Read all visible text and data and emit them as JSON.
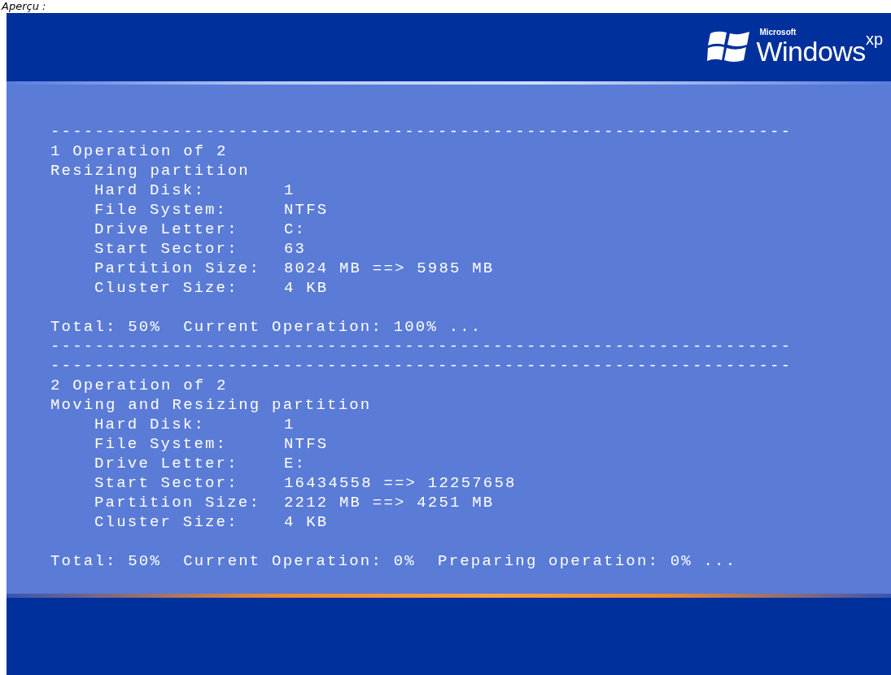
{
  "caption": "Aperçu :",
  "logo": {
    "company": "Microsoft",
    "product": "Windows",
    "edition": "xp"
  },
  "operations": [
    {
      "rule_top": "-------------------------------------------------------------------",
      "counter": "1 Operation of 2",
      "action": "Resizing partition",
      "fields": [
        {
          "label": "Hard Disk:",
          "value": "1"
        },
        {
          "label": "File System:",
          "value": "NTFS"
        },
        {
          "label": "Drive Letter:",
          "value": "C:"
        },
        {
          "label": "Start Sector:",
          "value": "63"
        },
        {
          "label": "Partition Size:",
          "value": "8024 MB ==> 5985 MB"
        },
        {
          "label": "Cluster Size:",
          "value": "4 KB"
        }
      ],
      "status": "Total: 50%  Current Operation: 100% ...",
      "rule_bottom": "-------------------------------------------------------------------"
    },
    {
      "rule_top": "-------------------------------------------------------------------",
      "counter": "2 Operation of 2",
      "action": "Moving and Resizing partition",
      "fields": [
        {
          "label": "Hard Disk:",
          "value": "1"
        },
        {
          "label": "File System:",
          "value": "NTFS"
        },
        {
          "label": "Drive Letter:",
          "value": "E:"
        },
        {
          "label": "Start Sector:",
          "value": "16434558 ==> 12257658"
        },
        {
          "label": "Partition Size:",
          "value": "2212 MB ==> 4251 MB"
        },
        {
          "label": "Cluster Size:",
          "value": "4 KB"
        }
      ],
      "status": "Total: 50%  Current Operation: 0%  Preparing operation: 0% ..."
    }
  ]
}
